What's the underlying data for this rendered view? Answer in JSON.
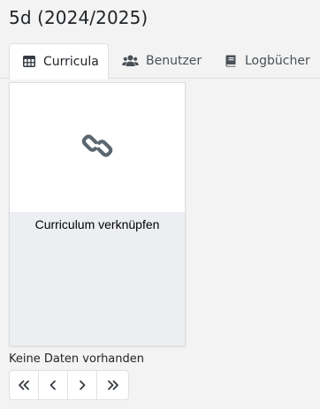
{
  "page": {
    "title": "5d (2024/2025)"
  },
  "tabs": [
    {
      "label": "Curricula",
      "icon": "table-icon",
      "active": true
    },
    {
      "label": "Benutzer",
      "icon": "users-icon",
      "active": false
    },
    {
      "label": "Logbücher",
      "icon": "book-icon",
      "active": false
    }
  ],
  "card": {
    "icon": "link-icon",
    "title": "Curriculum verknüpfen"
  },
  "empty": {
    "text": "Keine Daten vorhanden"
  },
  "pagination": {
    "buttons": [
      "first-page-icon",
      "prev-page-icon",
      "next-page-icon",
      "last-page-icon"
    ]
  },
  "colors": {
    "icon": "#5b6670",
    "text": "#212529",
    "border": "#dee2e6",
    "card_bg": "#eceef1"
  }
}
